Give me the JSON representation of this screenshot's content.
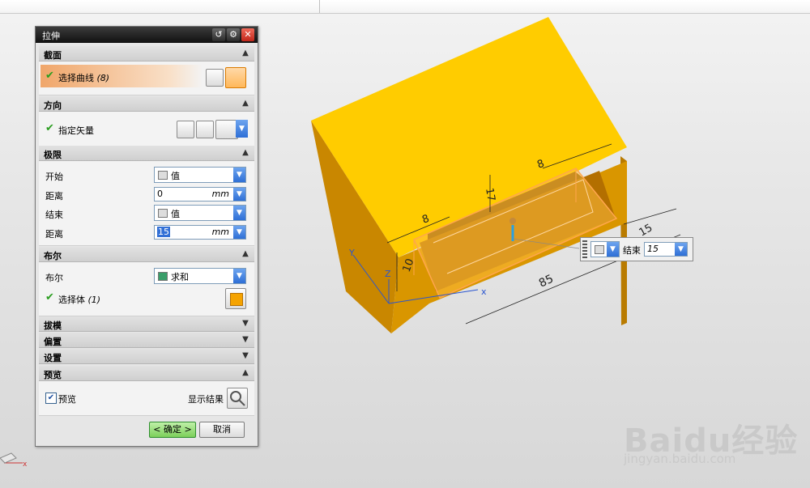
{
  "dialog": {
    "title": "拉伸",
    "sections": {
      "section": {
        "title": "截面",
        "select_curve_label": "选择曲线",
        "select_curve_count": "(8)"
      },
      "direction": {
        "title": "方向",
        "vector_label": "指定矢量"
      },
      "limits": {
        "title": "极限",
        "start_label": "开始",
        "start_option": "值",
        "start_distance_label": "距离",
        "start_distance_value": "0",
        "start_unit": "mm",
        "end_label": "结束",
        "end_option": "值",
        "end_distance_label": "距离",
        "end_distance_value": "15",
        "end_unit": "mm"
      },
      "boolean": {
        "title": "布尔",
        "boolean_label": "布尔",
        "boolean_option": "求和",
        "select_body_label": "选择体",
        "select_body_count": "(1)"
      },
      "draft": {
        "title": "拔模"
      },
      "offset": {
        "title": "偏置"
      },
      "settings": {
        "title": "设置"
      },
      "preview": {
        "title": "预览",
        "preview_label": "预览",
        "show_result_label": "显示结果"
      }
    },
    "ok_label": "< 确定 >",
    "cancel_label": "取消"
  },
  "canvas": {
    "dims": {
      "d8_left": "8",
      "d8_right": "8",
      "d17": "17",
      "d15": "15",
      "d85": "85",
      "d10": "10"
    },
    "axis_labels": {
      "x": "x",
      "y": "Y",
      "z": "Z",
      "triad_x": "x"
    },
    "handle": {
      "end_label": "结束",
      "end_value": "15"
    },
    "colors": {
      "solid_top": "#ffcc00",
      "solid_side_dark": "#c98700",
      "solid_side_front": "#d99600"
    }
  },
  "watermark": {
    "brand": "Baidu经验",
    "url": "jingyan.baidu.com"
  }
}
